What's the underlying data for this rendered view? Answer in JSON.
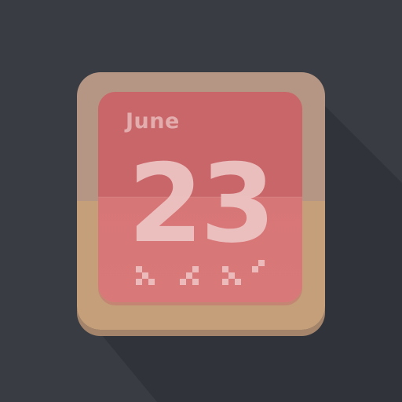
{
  "calendar": {
    "month": "June",
    "day": "23"
  },
  "colors": {
    "background": "#393d43",
    "frame": "#b59583",
    "face_top": "#c96669",
    "face_bottom": "#d77677",
    "text": "#eec3c3"
  },
  "icon": "calendar-icon"
}
